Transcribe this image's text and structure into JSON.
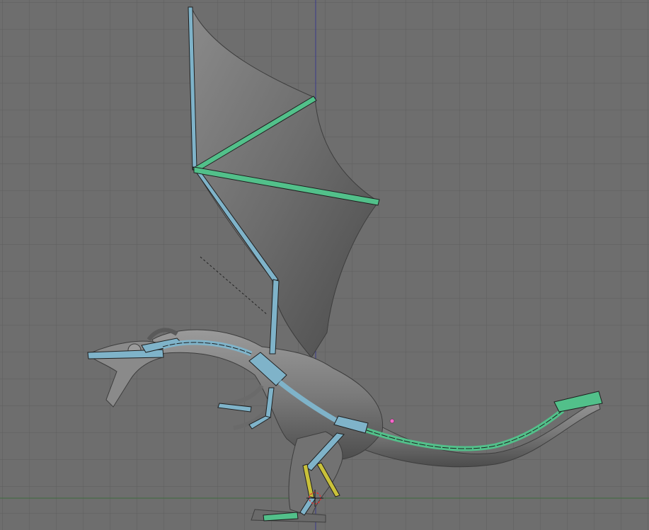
{
  "viewport": {
    "background": "#6e6e6e",
    "grid_color": "#5f5f5f",
    "axis_vertical_color": "#3b3b8a",
    "axis_horizontal_color": "#3f6a3f"
  },
  "scene": {
    "object": "dragon-mesh",
    "mesh_color": "#7c7c7c",
    "mesh_shadow_color": "#4e4e4e",
    "bone_color_blue": "#7fb3c9",
    "bone_color_green": "#52c08a",
    "bone_color_yellow": "#c9c13a",
    "bone_outline": "#1f1f1f",
    "cursor_icon": "3d-cursor-icon",
    "light_marker_color": "#ff66cc"
  }
}
